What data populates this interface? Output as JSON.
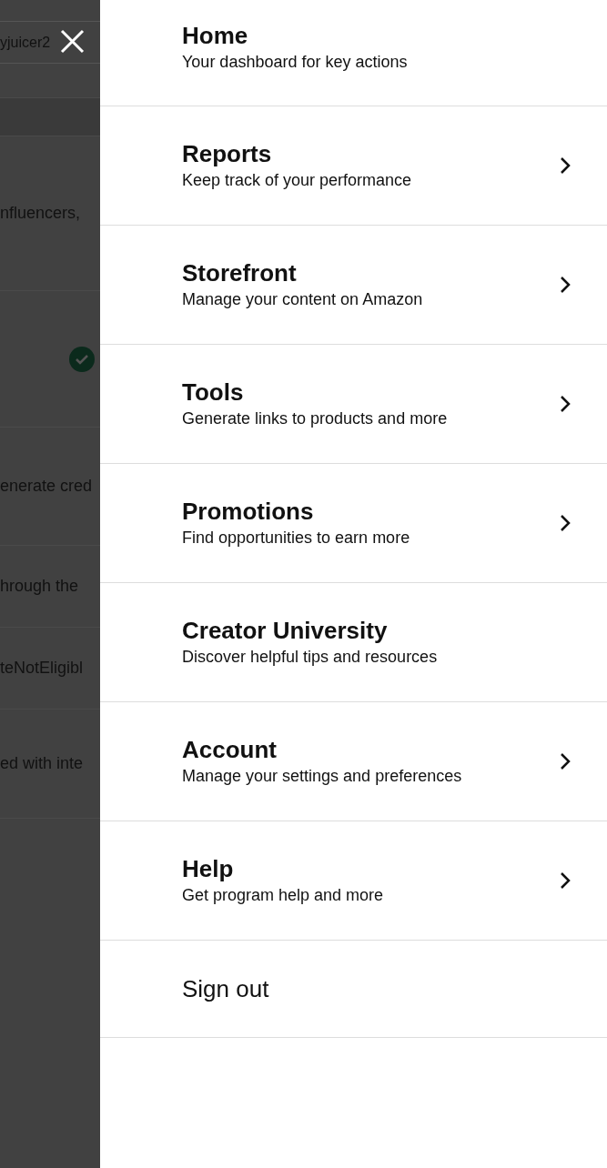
{
  "background_page": {
    "field_value": "yjuicer2",
    "texts": [
      {
        "kind": "text",
        "text": "nfluencers,"
      },
      {
        "kind": "check"
      },
      {
        "kind": "text",
        "text": "enerate cred"
      },
      {
        "kind": "text",
        "text": "hrough the"
      },
      {
        "kind": "text",
        "text": "teNotEligibl"
      },
      {
        "kind": "text",
        "text": "ed with inte"
      }
    ]
  },
  "menu": {
    "items": [
      {
        "title": "Home",
        "subtitle": "Your dashboard for key actions",
        "has_submenu": false
      },
      {
        "title": "Reports",
        "subtitle": "Keep track of your performance",
        "has_submenu": true
      },
      {
        "title": "Storefront",
        "subtitle": "Manage your content on Amazon",
        "has_submenu": true
      },
      {
        "title": "Tools",
        "subtitle": "Generate links to products and more",
        "has_submenu": true
      },
      {
        "title": "Promotions",
        "subtitle": "Find opportunities to earn more",
        "has_submenu": true
      },
      {
        "title": "Creator University",
        "subtitle": "Discover helpful tips and resources",
        "has_submenu": false
      },
      {
        "title": "Account",
        "subtitle": "Manage your settings and preferences",
        "has_submenu": true
      },
      {
        "title": "Help",
        "subtitle": "Get program help and more",
        "has_submenu": true
      }
    ],
    "sign_out": "Sign out"
  }
}
